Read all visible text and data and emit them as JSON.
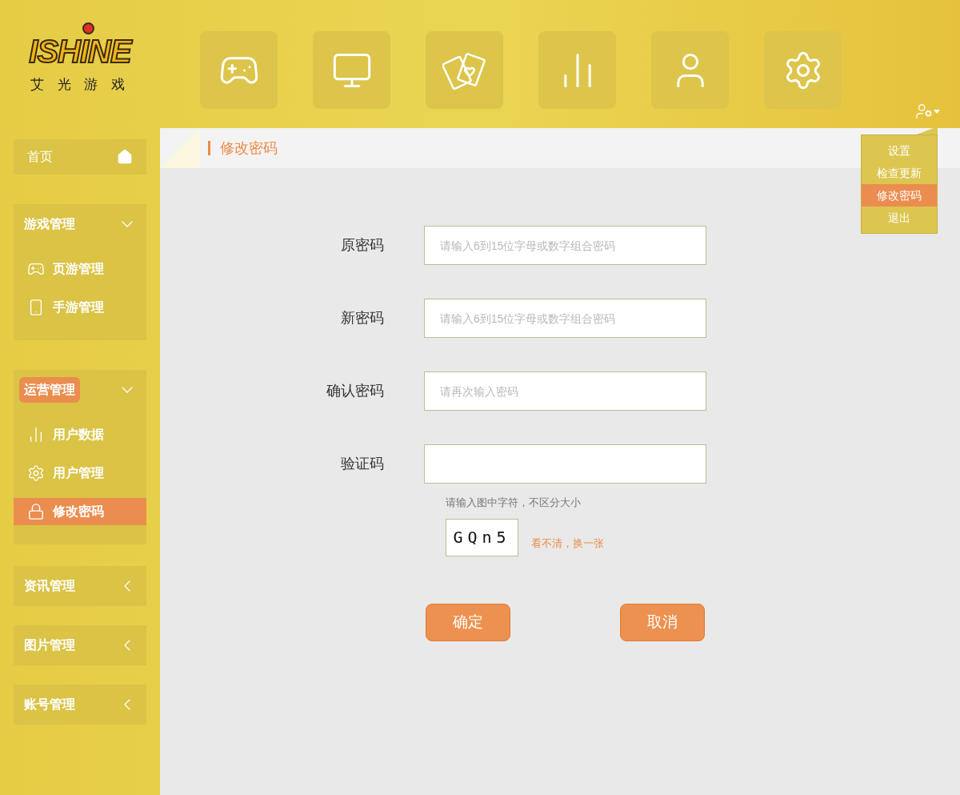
{
  "logo": {
    "wordmark": "ISHINE",
    "subtitle": "艾 光 游 戏"
  },
  "sidebar": {
    "home": {
      "label": "首页"
    },
    "groups": [
      {
        "label": "游戏管理",
        "highlighted": false,
        "expanded": true,
        "children": [
          {
            "label": "页游管理",
            "kind": "gamepad",
            "selected": false
          },
          {
            "label": "手游管理",
            "kind": "phone",
            "selected": false
          }
        ]
      },
      {
        "label": "运营管理",
        "highlighted": true,
        "expanded": true,
        "children": [
          {
            "label": "用户数据",
            "kind": "chart",
            "selected": false
          },
          {
            "label": "用户管理",
            "kind": "gear",
            "selected": false
          },
          {
            "label": "修改密码",
            "kind": "lock",
            "selected": true
          }
        ]
      },
      {
        "label": "资讯管理",
        "highlighted": false,
        "expanded": false
      },
      {
        "label": "图片管理",
        "highlighted": false,
        "expanded": false
      },
      {
        "label": "账号管理",
        "highlighted": false,
        "expanded": false
      }
    ]
  },
  "user_menu": {
    "items": [
      {
        "label": "设置",
        "selected": false
      },
      {
        "label": "检查更新",
        "selected": false
      },
      {
        "label": "修改密码",
        "selected": true
      },
      {
        "label": "退出",
        "selected": false
      }
    ]
  },
  "page_header": {
    "title": "修改密码"
  },
  "form": {
    "fields": [
      {
        "label": "原密码",
        "placeholder": "请输入6到15位字母或数字组合密码"
      },
      {
        "label": "新密码",
        "placeholder": "请输入6到15位字母或数字组合密码"
      },
      {
        "label": "确认密码",
        "placeholder": "请再次输入密码"
      },
      {
        "label": "验证码"
      }
    ],
    "captcha_hint": "请输入图中字符，不区分大小",
    "captcha_text": "GQn5",
    "refresh_link": "看不清，换一张",
    "buttons": [
      "确定",
      "取消"
    ]
  }
}
